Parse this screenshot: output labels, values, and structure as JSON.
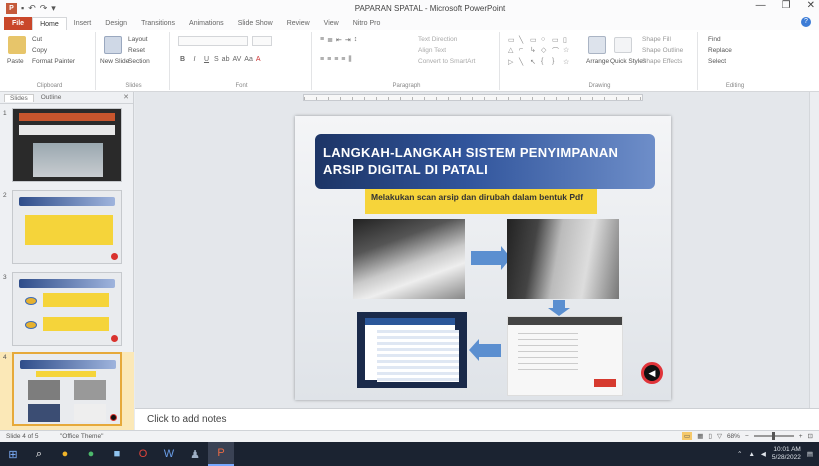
{
  "window": {
    "title": "PAPARAN SPATAL - Microsoft PowerPoint",
    "controls": [
      "—",
      "❐",
      "✕"
    ]
  },
  "ribbon_tabs": [
    "File",
    "Home",
    "Insert",
    "Design",
    "Transitions",
    "Animations",
    "Slide Show",
    "Review",
    "View",
    "Nitro Pro"
  ],
  "ribbon": {
    "clipboard": {
      "cut": "Cut",
      "copy": "Copy",
      "format_painter": "Format Painter",
      "paste": "Paste",
      "label": "Clipboard"
    },
    "slides": {
      "new_slide": "New Slide",
      "layout": "Layout",
      "reset": "Reset",
      "section": "Section",
      "label": "Slides"
    },
    "font": {
      "label": "Font"
    },
    "paragraph": {
      "text_direction": "Text Direction",
      "align_text": "Align Text",
      "convert": "Convert to SmartArt",
      "label": "Paragraph"
    },
    "drawing": {
      "arrange": "Arrange",
      "quick_styles": "Quick Styles",
      "shape_fill": "Shape Fill",
      "shape_outline": "Shape Outline",
      "shape_effects": "Shape Effects",
      "label": "Drawing"
    },
    "editing": {
      "find": "Find",
      "replace": "Replace",
      "select": "Select",
      "label": "Editing"
    }
  },
  "left_pane": {
    "tabs": [
      "Slides",
      "Outline"
    ],
    "close": "✕",
    "slide_numbers": [
      "1",
      "2",
      "3",
      "4"
    ]
  },
  "slide": {
    "title": "LANGKAH-LANGKAH SISTEM PENYIMPANAN ARSIP DIGITAL DI PATALI",
    "caption": "Melakukan scan arsip dan dirubah dalam bentuk Pdf",
    "nav_icon": "◀"
  },
  "notes": {
    "placeholder": "Click to add notes"
  },
  "statusbar": {
    "slide_info": "Slide 4 of 5",
    "theme": "\"Office Theme\"",
    "zoom": "68%"
  },
  "taskbar": {
    "items": [
      "windows-start-icon",
      "search-icon",
      "chrome-icon",
      "chrome-icon",
      "file-explorer-icon",
      "opera-icon",
      "word-icon",
      "app-icon",
      "powerpoint-icon"
    ],
    "clock_time": "10:01 AM",
    "clock_date": "5/28/2022"
  },
  "colors": {
    "file_tab": "#c9472a",
    "slide_title_bg": "#1d3566",
    "caption_bg": "#f6d43a",
    "arrow": "#5b8fd0",
    "selected_thumb": "#e6a93a",
    "taskbar": "#1b2331"
  }
}
